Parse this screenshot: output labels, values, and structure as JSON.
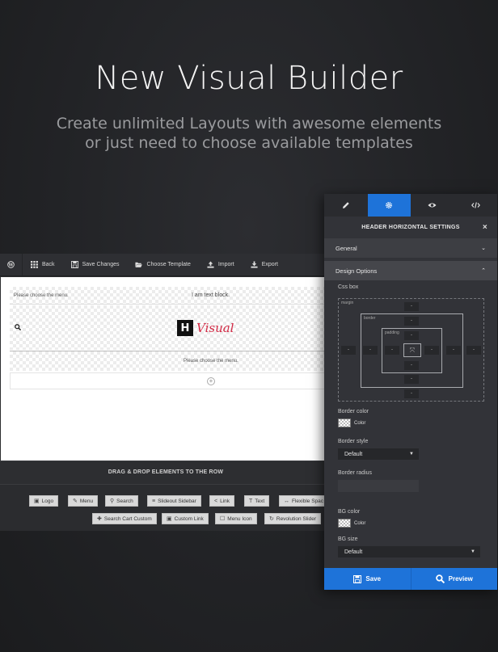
{
  "hero": {
    "title": "New Visual Builder",
    "subtitle_line1": "Create unlimited Layouts with awesome elements",
    "subtitle_line2": "or just need to choose available templates"
  },
  "toolbar": {
    "back": "Back",
    "save_changes": "Save Changes",
    "choose_template": "Choose Template",
    "import": "Import",
    "export": "Export"
  },
  "canvas": {
    "menu_placeholder_top": "Please choose the menu.",
    "text_block": "I am text block.",
    "logo_mark": "H",
    "logo_text": "Visual",
    "menu_placeholder_bottom": "Please choose the menu.",
    "add_row": "+"
  },
  "drag_drop_label": "DRAG & DROP ELEMENTS TO THE ROW",
  "elements": [
    {
      "label": "Logo",
      "icon": "image-icon"
    },
    {
      "label": "Menu",
      "icon": "link-icon"
    },
    {
      "label": "Search",
      "icon": "search-icon"
    },
    {
      "label": "Slideout Sidebar",
      "icon": "bars-icon"
    },
    {
      "label": "Link",
      "icon": "share-icon"
    },
    {
      "label": "Text",
      "icon": "text-icon"
    },
    {
      "label": "Flexible Spac",
      "icon": "arrows-icon"
    },
    {
      "label": "Search Cart Custom",
      "icon": "plus-icon"
    },
    {
      "label": "Custom Link",
      "icon": "image-icon"
    },
    {
      "label": "Menu Icon",
      "icon": "square-icon"
    },
    {
      "label": "Revolution Slider",
      "icon": "refresh-icon"
    }
  ],
  "panel": {
    "title": "HEADER HORIZONTAL SETTINGS",
    "close": "×",
    "section_general": "General",
    "section_design": "Design Options",
    "css_box_label": "Css box",
    "margin_label": "margin",
    "border_label": "border",
    "padding_label": "padding",
    "dash": "-",
    "border_color_label": "Border color",
    "border_color_button": "Color",
    "border_style_label": "Border style",
    "border_style_value": "Default",
    "border_radius_label": "Border radius",
    "bg_color_label": "BG color",
    "bg_color_button": "Color",
    "bg_size_label": "BG size",
    "bg_size_value": "Default",
    "save": "Save",
    "preview": "Preview"
  },
  "colors": {
    "accent": "#1e73d9",
    "logo_red": "#d22a45",
    "background": "#222326"
  }
}
